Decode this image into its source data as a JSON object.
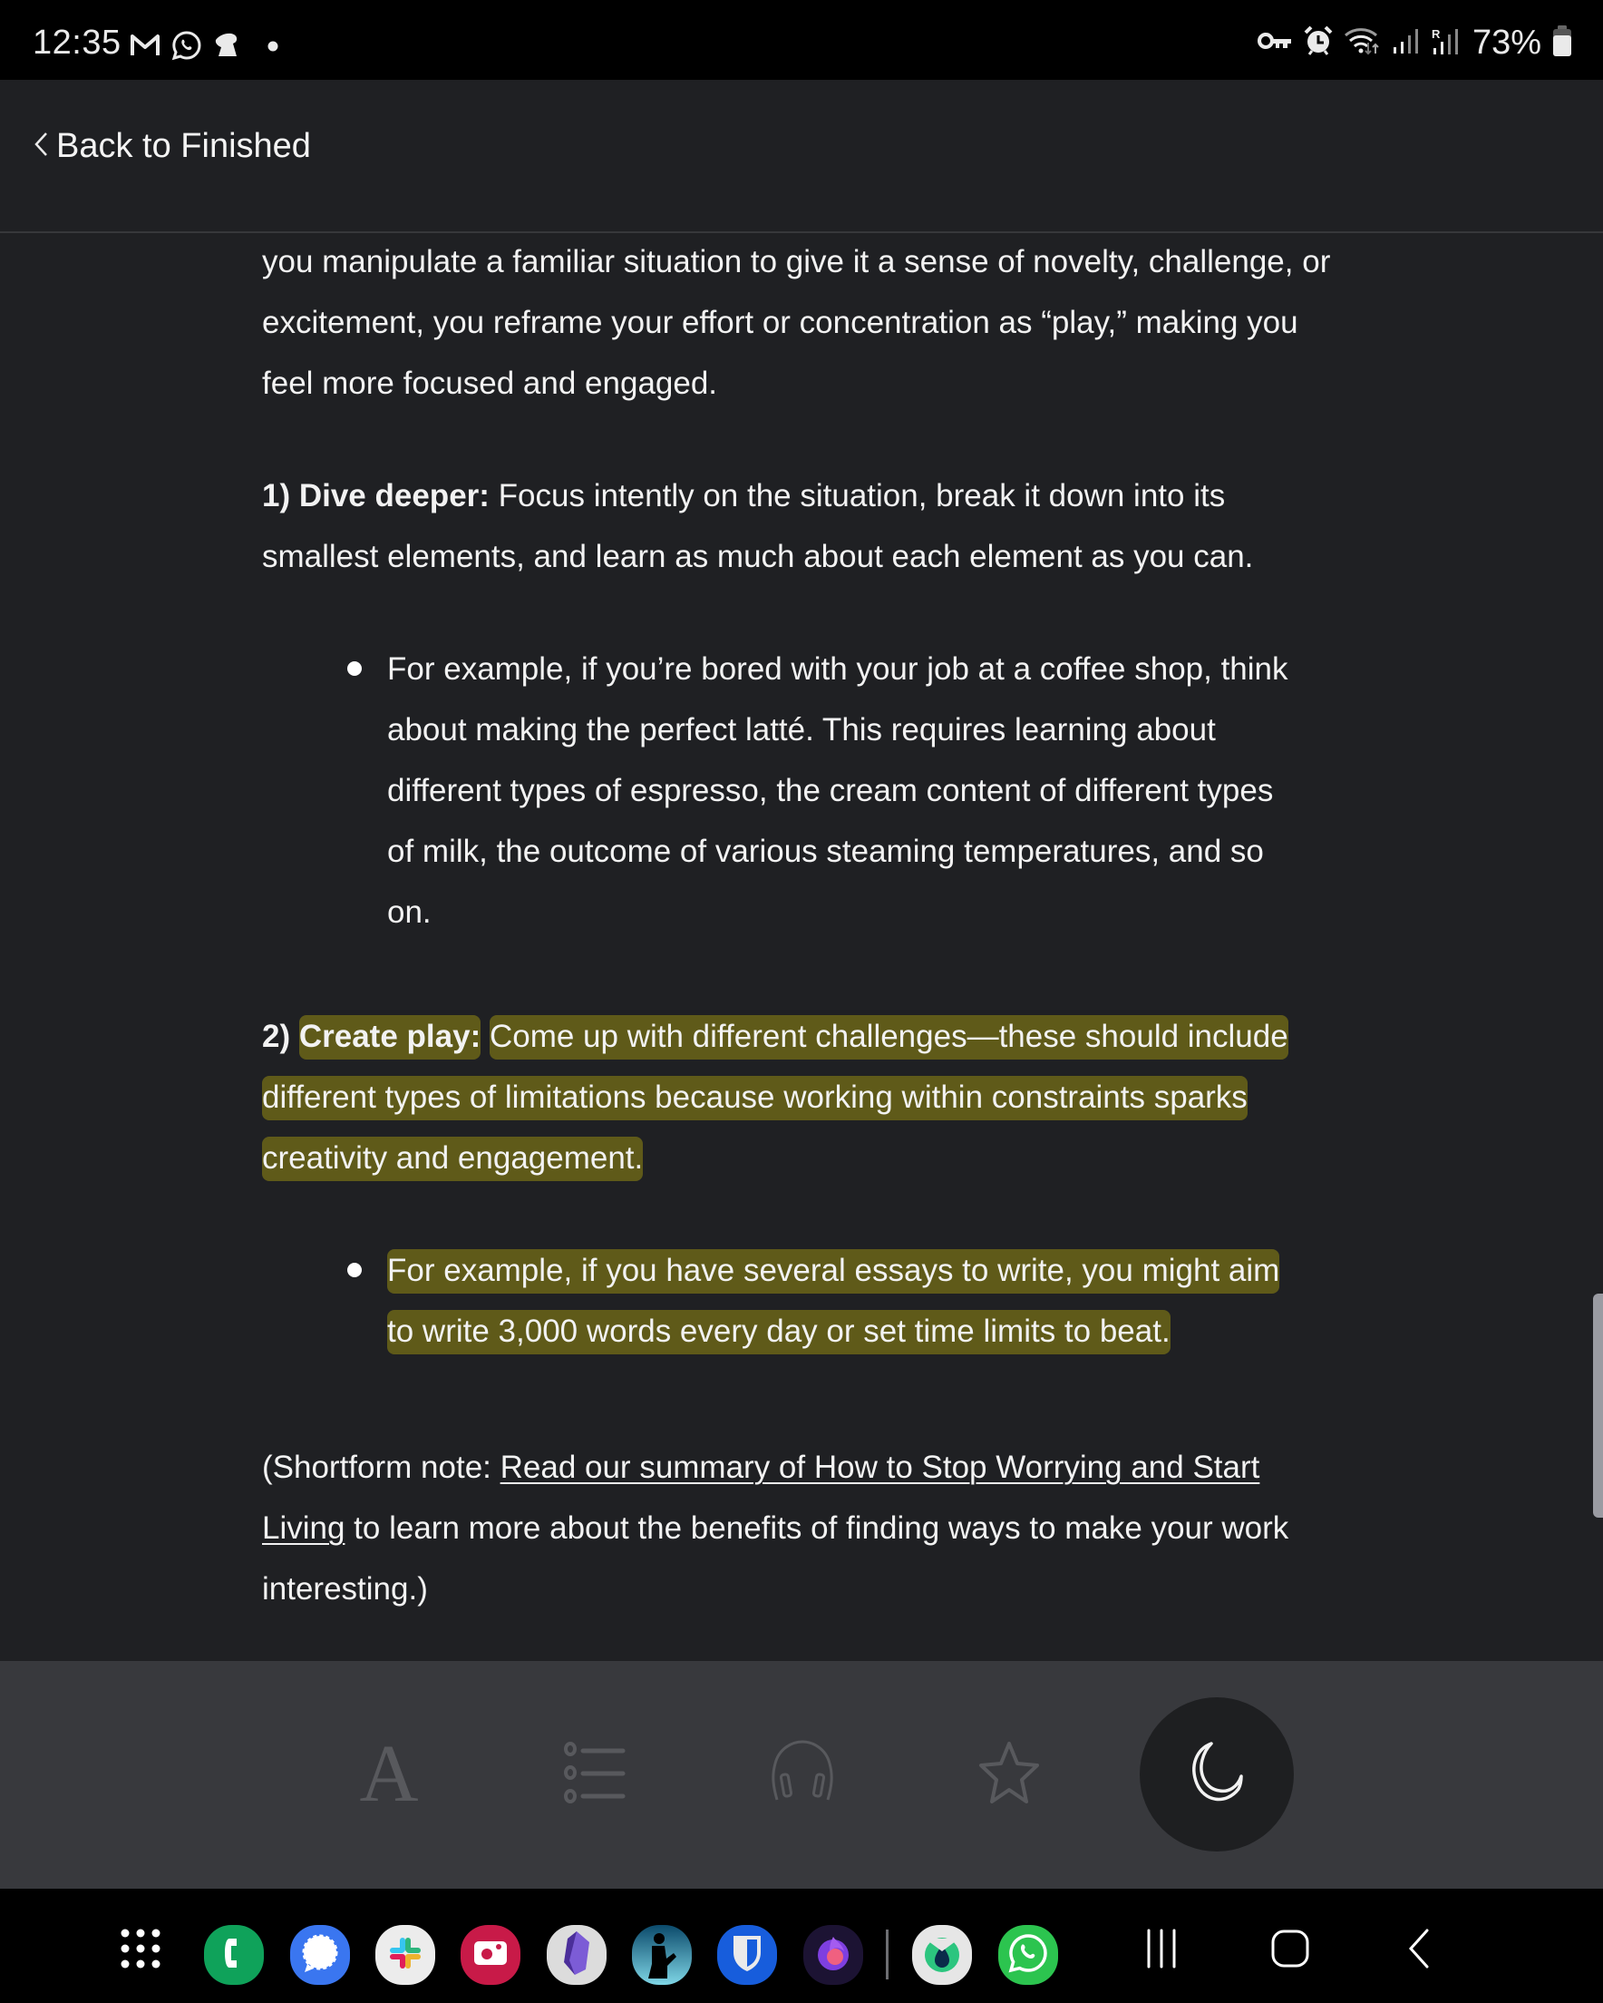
{
  "status_bar": {
    "time": "12:35",
    "left_icons": [
      "gmail-icon",
      "whatsapp-icon",
      "incognito-icon",
      "dot-icon"
    ],
    "right_icons": [
      "vpn-key-icon",
      "alarm-icon",
      "wifi-icon",
      "signal-icon",
      "roaming-signal-icon",
      "battery-icon"
    ],
    "battery_percent": "73%",
    "battery_level": 0.73
  },
  "header": {
    "back_label": "Back to Finished"
  },
  "content": {
    "intro": "you manipulate a familiar situation to give it a sense of novelty, challenge, or excitement, you reframe your effort or concentration as “play,” making you feel more focused and engaged.",
    "step1": {
      "label": "1) Dive deeper:",
      "text": " Focus intently on the situation, break it down into its smallest elements, and learn as much about each element as you can.",
      "bullet": "For example, if you’re bored with your job at a coffee shop, think about making the perfect latté. This requires learning about different types of espresso, the cream content of different types of milk, the outcome of various steaming temperatures, and so on."
    },
    "step2": {
      "number": "2)",
      "label": "Create play:",
      "text": "Come up with different challenges—these should include different types of limitations because working within constraints sparks creativity and engagement.",
      "bullet": "For example, if you have several essays to write, you might aim to write 3,000 words every day or set time limits to beat."
    },
    "note": {
      "prefix": "(Shortform note: ",
      "link": "Read our summary of How to Stop Worrying and Start Living",
      "suffix": " to learn more about the benefits of finding ways to make your work interesting.)"
    },
    "highlight_color": "#5f5a19"
  },
  "scroll": {
    "position": 0.78
  },
  "toolbar": {
    "font_label": "A",
    "items": [
      "font-settings",
      "table-of-contents",
      "audio",
      "favorite",
      "night-mode"
    ],
    "active": "night-mode"
  },
  "nav_bar": {
    "apps": [
      "Phone",
      "Signal",
      "Slack",
      "Screen Recorder",
      "Obsidian",
      "Kindle",
      "Bitwarden",
      "Firefox Focus",
      "Blinkist",
      "WhatsApp"
    ],
    "buttons": [
      "recents",
      "home",
      "back"
    ]
  }
}
